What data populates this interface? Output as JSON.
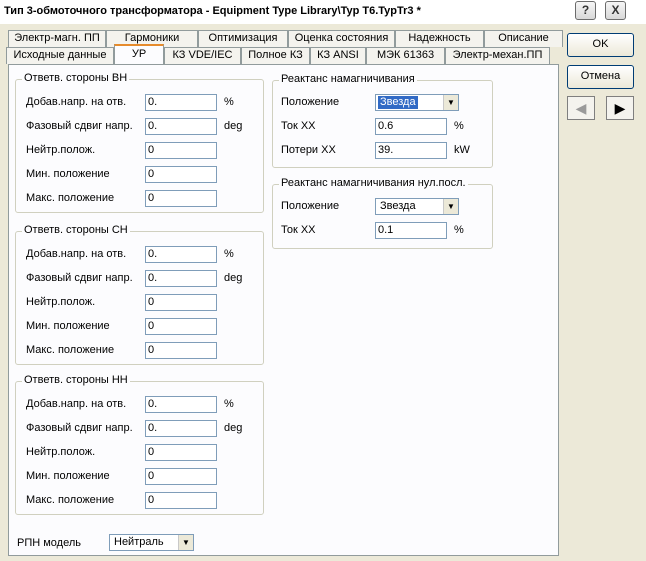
{
  "window": {
    "title": "Тип 3-обмоточного трансформатора - Equipment Type Library\\Typ T6.TypTr3 *",
    "help_label": "?",
    "close_label": "X"
  },
  "tabs_back": [
    "Электр-магн. ПП",
    "Гармоники",
    "Оптимизация",
    "Оценка состояния",
    "Надежность",
    "Описание"
  ],
  "tabs_front": [
    "Исходные данные",
    "УР",
    "КЗ VDE/IEC",
    "Полное КЗ",
    "КЗ ANSI",
    "МЭК 61363",
    "Электр-механ.ПП"
  ],
  "groups": {
    "hv": {
      "title": "Ответв. стороны ВН",
      "fields": [
        {
          "label": "Добав.напр. на отв.",
          "value": "0.",
          "unit": "%"
        },
        {
          "label": "Фазовый сдвиг напр.",
          "value": "0.",
          "unit": "deg"
        },
        {
          "label": "Нейтр.полож.",
          "value": "0",
          "unit": ""
        },
        {
          "label": "Мин. положение",
          "value": "0",
          "unit": ""
        },
        {
          "label": "Макс. положение",
          "value": "0",
          "unit": ""
        }
      ]
    },
    "mv": {
      "title": "Ответв. стороны СН",
      "fields": [
        {
          "label": "Добав.напр. на отв.",
          "value": "0.",
          "unit": "%"
        },
        {
          "label": "Фазовый сдвиг напр.",
          "value": "0.",
          "unit": "deg"
        },
        {
          "label": "Нейтр.полож.",
          "value": "0",
          "unit": ""
        },
        {
          "label": "Мин. положение",
          "value": "0",
          "unit": ""
        },
        {
          "label": "Макс. положение",
          "value": "0",
          "unit": ""
        }
      ]
    },
    "lv": {
      "title": "Ответв. стороны НН",
      "fields": [
        {
          "label": "Добав.напр. на отв.",
          "value": "0.",
          "unit": "%"
        },
        {
          "label": "Фазовый сдвиг напр.",
          "value": "0.",
          "unit": "deg"
        },
        {
          "label": "Нейтр.полож.",
          "value": "0",
          "unit": ""
        },
        {
          "label": "Мин. положение",
          "value": "0",
          "unit": ""
        },
        {
          "label": "Макс. положение",
          "value": "0",
          "unit": ""
        }
      ]
    },
    "mag": {
      "title": "Реактанс намагничивания",
      "position_label": "Положение",
      "position_value": "Звезда",
      "noload_current_label": "Ток ХХ",
      "noload_current_value": "0.6",
      "noload_current_unit": "%",
      "noload_loss_label": "Потери ХХ",
      "noload_loss_value": "39.",
      "noload_loss_unit": "kW"
    },
    "mag0": {
      "title": "Реактанс намагничивания нул.посл.",
      "position_label": "Положение",
      "position_value": "Звезда",
      "noload_current_label": "Ток ХХ",
      "noload_current_value": "0.1",
      "noload_current_unit": "%"
    }
  },
  "oltc": {
    "label": "РПН модель",
    "value": "Нейтраль"
  },
  "buttons": {
    "ok": "OK",
    "cancel": "Отмена",
    "prev": "◀",
    "next": "▶"
  },
  "icons": {
    "dropdown": "▼"
  }
}
